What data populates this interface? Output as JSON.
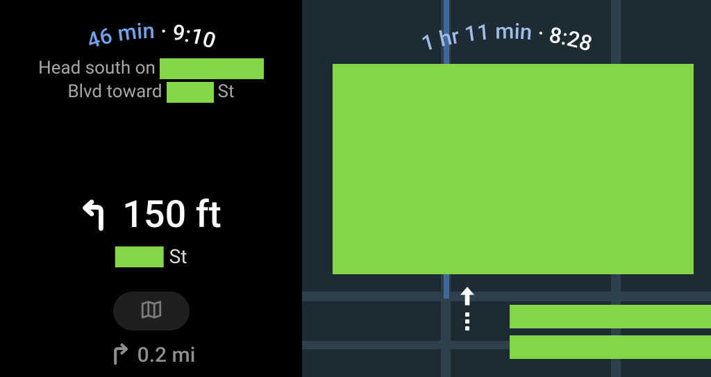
{
  "left": {
    "eta": {
      "duration": "46 min",
      "separator": " · ",
      "time": "9:10"
    },
    "direction": {
      "line1_prefix": "Head south on",
      "line2_prefix": "Blvd toward",
      "line2_suffix": "St"
    },
    "turn": {
      "distance": "150 ft",
      "street_suffix": "St"
    },
    "peek": {
      "distance": "0.2 mi"
    }
  },
  "right": {
    "eta": {
      "duration": "1 hr 11 min",
      "separator": " · ",
      "time": "8:28"
    }
  },
  "colors": {
    "redact": "#84d547",
    "accent_blue": "#72a1e8",
    "map_bg": "#1c2b34"
  }
}
